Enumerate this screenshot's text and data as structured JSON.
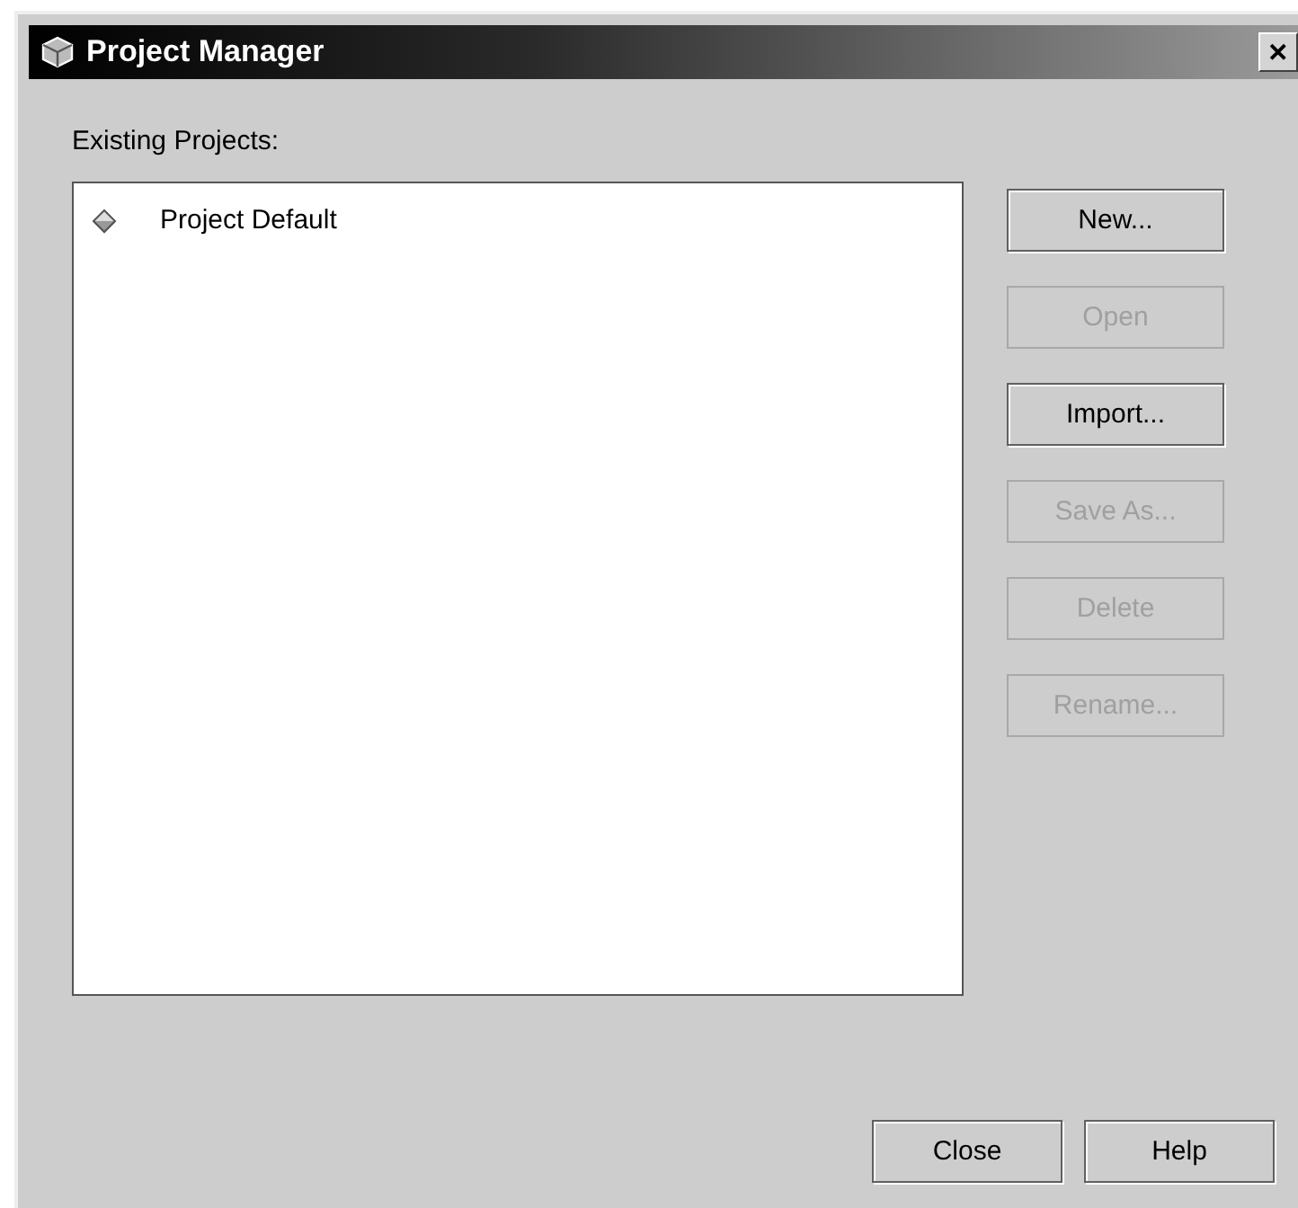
{
  "window": {
    "title": "Project Manager",
    "close": "✕"
  },
  "list_label": "Existing Projects:",
  "projects": [
    {
      "name": "Project Default",
      "selected": false
    }
  ],
  "side_buttons": [
    {
      "label": "New...",
      "disabled": false
    },
    {
      "label": "Open",
      "disabled": true
    },
    {
      "label": "Import...",
      "disabled": false
    },
    {
      "label": "Save As...",
      "disabled": true
    },
    {
      "label": "Delete",
      "disabled": true
    },
    {
      "label": "Rename...",
      "disabled": true
    }
  ],
  "bottom_buttons": [
    {
      "label": "Close",
      "disabled": false
    },
    {
      "label": "Help",
      "disabled": false
    }
  ]
}
